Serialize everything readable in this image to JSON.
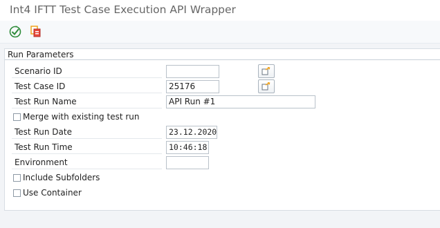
{
  "window": {
    "title": "Int4 IFTT Test Case Execution API Wrapper"
  },
  "toolbar": {
    "items": [
      {
        "name": "execute-icon"
      },
      {
        "name": "variants-icon"
      }
    ]
  },
  "run_parameters": {
    "group_title": "Run Parameters",
    "scenario_id": {
      "label": "Scenario ID",
      "value": ""
    },
    "test_case_id": {
      "label": "Test Case ID",
      "value": "25176"
    },
    "test_run_name": {
      "label": "Test Run Name",
      "value": "API Run #1"
    },
    "merge_existing": {
      "label": "Merge with existing test run",
      "checked": false
    },
    "test_run_date": {
      "label": "Test Run Date",
      "value": "23.12.2020"
    },
    "test_run_time": {
      "label": "Test Run Time",
      "value": "10:46:18"
    },
    "environment": {
      "label": "Environment",
      "value": ""
    },
    "include_subfolders": {
      "label": "Include Subfolders",
      "checked": false
    },
    "use_container": {
      "label": "Use Container",
      "checked": false
    }
  },
  "colors": {
    "title_text": "#666666",
    "toolbar_bg": "#f7f9fb",
    "content_bg": "#f2f4f7",
    "accent_green": "#2e8b3a",
    "accent_orange": "#f0a21b"
  }
}
